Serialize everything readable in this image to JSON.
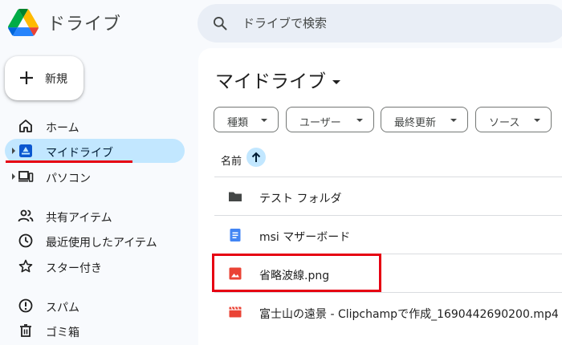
{
  "app": {
    "title": "ドライブ",
    "logo": "google-drive-logo"
  },
  "search": {
    "placeholder": "ドライブで検索",
    "icon": "search-icon"
  },
  "sidebar": {
    "new_button": {
      "label": "新規",
      "icon": "plus-icon"
    },
    "items": [
      {
        "label": "ホーム",
        "icon": "home-icon",
        "active": false,
        "expandable": false
      },
      {
        "label": "マイドライブ",
        "icon": "my-drive-icon",
        "active": true,
        "expandable": true
      },
      {
        "label": "パソコン",
        "icon": "computers-icon",
        "active": false,
        "expandable": true
      },
      {
        "label": "共有アイテム",
        "icon": "shared-icon",
        "active": false,
        "expandable": false
      },
      {
        "label": "最近使用したアイテム",
        "icon": "clock-icon",
        "active": false,
        "expandable": false
      },
      {
        "label": "スター付き",
        "icon": "star-icon",
        "active": false,
        "expandable": false
      },
      {
        "label": "スパム",
        "icon": "spam-icon",
        "active": false,
        "expandable": false
      },
      {
        "label": "ゴミ箱",
        "icon": "trash-icon",
        "active": false,
        "expandable": false
      }
    ]
  },
  "main": {
    "title": "マイドライブ",
    "filters": [
      {
        "label": "種類"
      },
      {
        "label": "ユーザー"
      },
      {
        "label": "最終更新"
      },
      {
        "label": "ソース"
      }
    ],
    "sort": {
      "label": "名前",
      "direction": "ascending"
    },
    "files": [
      {
        "name": "テスト フォルダ",
        "type": "folder",
        "color": "#444746"
      },
      {
        "name": "msi マザーボード",
        "type": "google-doc",
        "color": "#4285f4"
      },
      {
        "name": "省略波線.png",
        "type": "image",
        "color": "#ea4335"
      },
      {
        "name": "富士山の遠景 - Clipchampで作成_1690442690200.mp4",
        "type": "video",
        "color": "#ea4335"
      }
    ]
  },
  "colors": {
    "accent": "#c2e7ff",
    "annotation_red": "#e60012",
    "background": "#f8fafd",
    "search_bg": "#e9eef6"
  }
}
